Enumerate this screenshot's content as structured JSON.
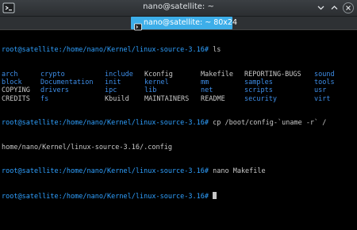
{
  "window": {
    "title": "nano@satellite: ~",
    "buttons": [
      "chevron-down-icon",
      "chevron-up-icon",
      "close-icon"
    ]
  },
  "tab": {
    "label": "nano@satellite: ~ 80x24"
  },
  "terminal": {
    "prompt": "root@satellite:/home/nano/Kernel/linux-source-3.16#",
    "commands": {
      "ls": " ls",
      "cp_line1": " cp /boot/config-`uname -r` /",
      "cp_line2": "home/nano/Kernel/linux-source-3.16/.config",
      "nano": " nano Makefile",
      "last": " "
    },
    "ls_rows": [
      [
        {
          "text": "arch",
          "type": "dir"
        },
        {
          "text": "crypto",
          "type": "dir"
        },
        {
          "text": "include",
          "type": "dir"
        },
        {
          "text": "Kconfig",
          "type": "file"
        },
        {
          "text": "Makefile",
          "type": "file"
        },
        {
          "text": "REPORTING-BUGS",
          "type": "file"
        },
        {
          "text": "sound",
          "type": "dir"
        }
      ],
      [
        {
          "text": "block",
          "type": "dir"
        },
        {
          "text": "Documentation",
          "type": "dir"
        },
        {
          "text": "init",
          "type": "dir"
        },
        {
          "text": "kernel",
          "type": "dir"
        },
        {
          "text": "mm",
          "type": "dir"
        },
        {
          "text": "samples",
          "type": "dir"
        },
        {
          "text": "tools",
          "type": "dir"
        }
      ],
      [
        {
          "text": "COPYING",
          "type": "file"
        },
        {
          "text": "drivers",
          "type": "dir"
        },
        {
          "text": "ipc",
          "type": "dir"
        },
        {
          "text": "lib",
          "type": "dir"
        },
        {
          "text": "net",
          "type": "dir"
        },
        {
          "text": "scripts",
          "type": "dir"
        },
        {
          "text": "usr",
          "type": "dir"
        }
      ],
      [
        {
          "text": "CREDITS",
          "type": "file"
        },
        {
          "text": "fs",
          "type": "dir"
        },
        {
          "text": "Kbuild",
          "type": "file"
        },
        {
          "text": "MAINTAINERS",
          "type": "file"
        },
        {
          "text": "README",
          "type": "file"
        },
        {
          "text": "security",
          "type": "dir"
        },
        {
          "text": "virt",
          "type": "dir"
        }
      ]
    ]
  },
  "colors": {
    "background": "#000000",
    "prompt": "#2fa0ff",
    "directory": "#3e8ee8",
    "text": "#c8c8c8",
    "tab_active": "#3daee9",
    "titlebar": "#2b2e31"
  }
}
